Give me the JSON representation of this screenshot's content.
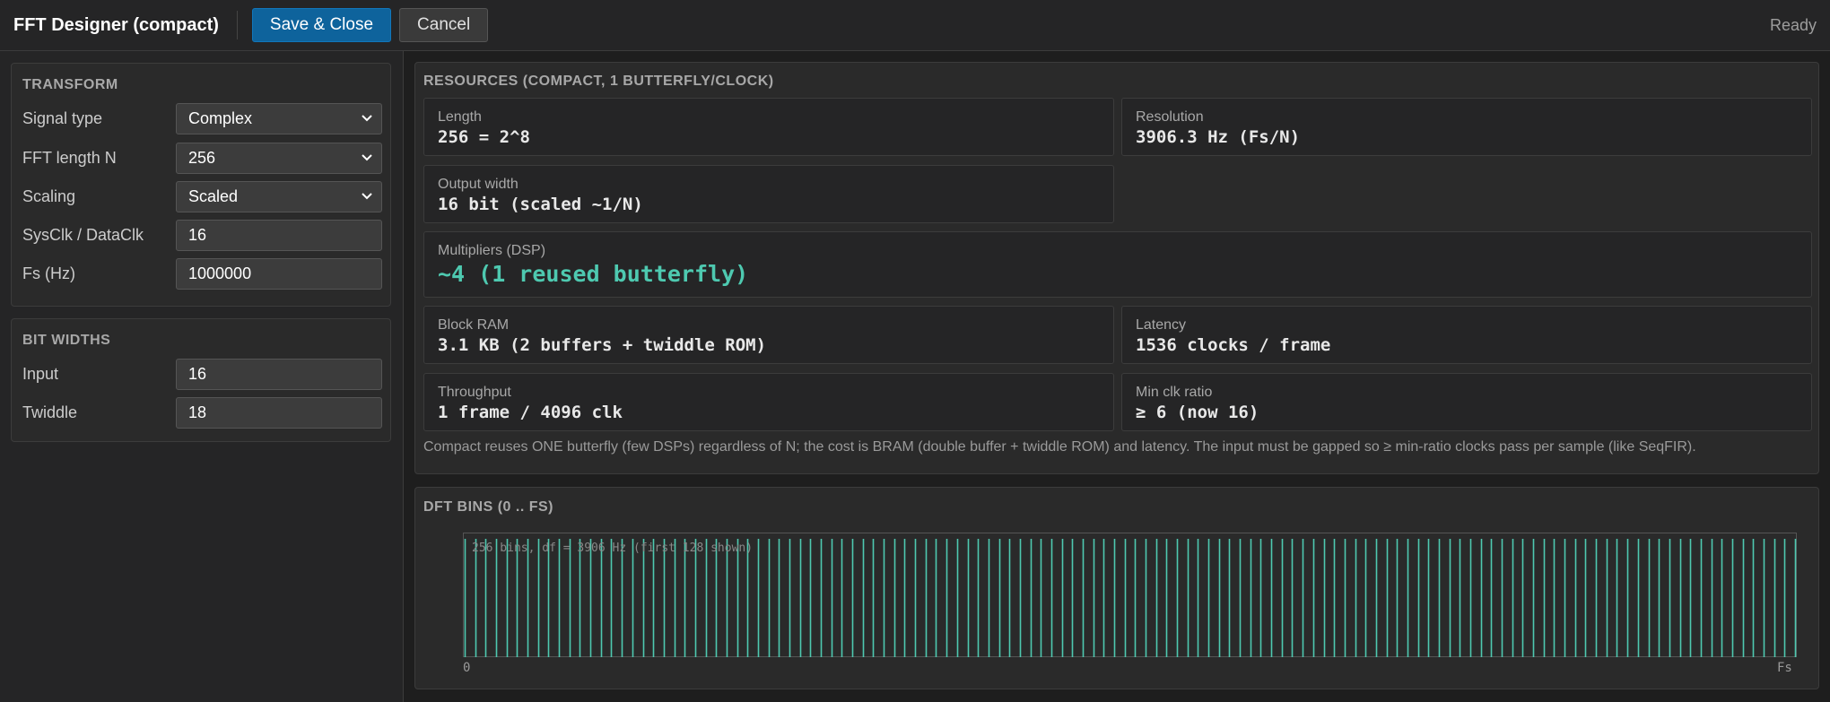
{
  "header": {
    "title": "FFT Designer (compact)",
    "save_label": "Save & Close",
    "cancel_label": "Cancel",
    "status": "Ready"
  },
  "transform": {
    "title": "TRANSFORM",
    "fields": [
      {
        "label": "Signal type",
        "value": "Complex",
        "kind": "select"
      },
      {
        "label": "FFT length N",
        "value": "256",
        "kind": "select"
      },
      {
        "label": "Scaling",
        "value": "Scaled",
        "kind": "select"
      },
      {
        "label": "SysClk / DataClk",
        "value": "16",
        "kind": "input"
      },
      {
        "label": "Fs (Hz)",
        "value": "1000000",
        "kind": "input"
      }
    ]
  },
  "bitwidths": {
    "title": "BIT WIDTHS",
    "fields": [
      {
        "label": "Input",
        "value": "16",
        "kind": "input"
      },
      {
        "label": "Twiddle",
        "value": "18",
        "kind": "input"
      }
    ]
  },
  "resources": {
    "title": "RESOURCES (COMPACT, 1 BUTTERFLY/CLOCK)",
    "length": {
      "label": "Length",
      "value": "256 = 2^8"
    },
    "resolution": {
      "label": "Resolution",
      "value": "3906.3 Hz (Fs/N)"
    },
    "output_width": {
      "label": "Output width",
      "value": "16 bit (scaled ~1/N)"
    },
    "multipliers": {
      "label": "Multipliers (DSP)",
      "value": "~4 (1 reused butterfly)"
    },
    "block_ram": {
      "label": "Block RAM",
      "value": "3.1 KB (2 buffers + twiddle ROM)"
    },
    "latency": {
      "label": "Latency",
      "value": "1536 clocks / frame"
    },
    "throughput": {
      "label": "Throughput",
      "value": "1 frame / 4096 clk"
    },
    "min_clk": {
      "label": "Min clk ratio",
      "value": "≥ 6 (now 16)"
    },
    "note": "Compact reuses ONE butterfly (few DSPs) regardless of N; the cost is BRAM (double buffer + twiddle ROM) and latency. The input must be gapped so ≥ min-ratio clocks pass per sample (like SeqFIR)."
  },
  "bins": {
    "title": "DFT BINS (0 .. FS)",
    "chart_note": "256 bins, df = 3906 Hz  (first 128 shown)",
    "x_start": "0",
    "x_end": "Fs",
    "accent": "#4ec9b0"
  },
  "chart_data": {
    "type": "bar",
    "title": "DFT BINS (0 .. FS)",
    "annotation": "256 bins, df = 3906 Hz  (first 128 shown)",
    "bins_shown": 128,
    "bins_total": 256,
    "x_tick_labels": [
      "0",
      "Fs"
    ],
    "values_note": "uniform bin markers, each full height"
  }
}
